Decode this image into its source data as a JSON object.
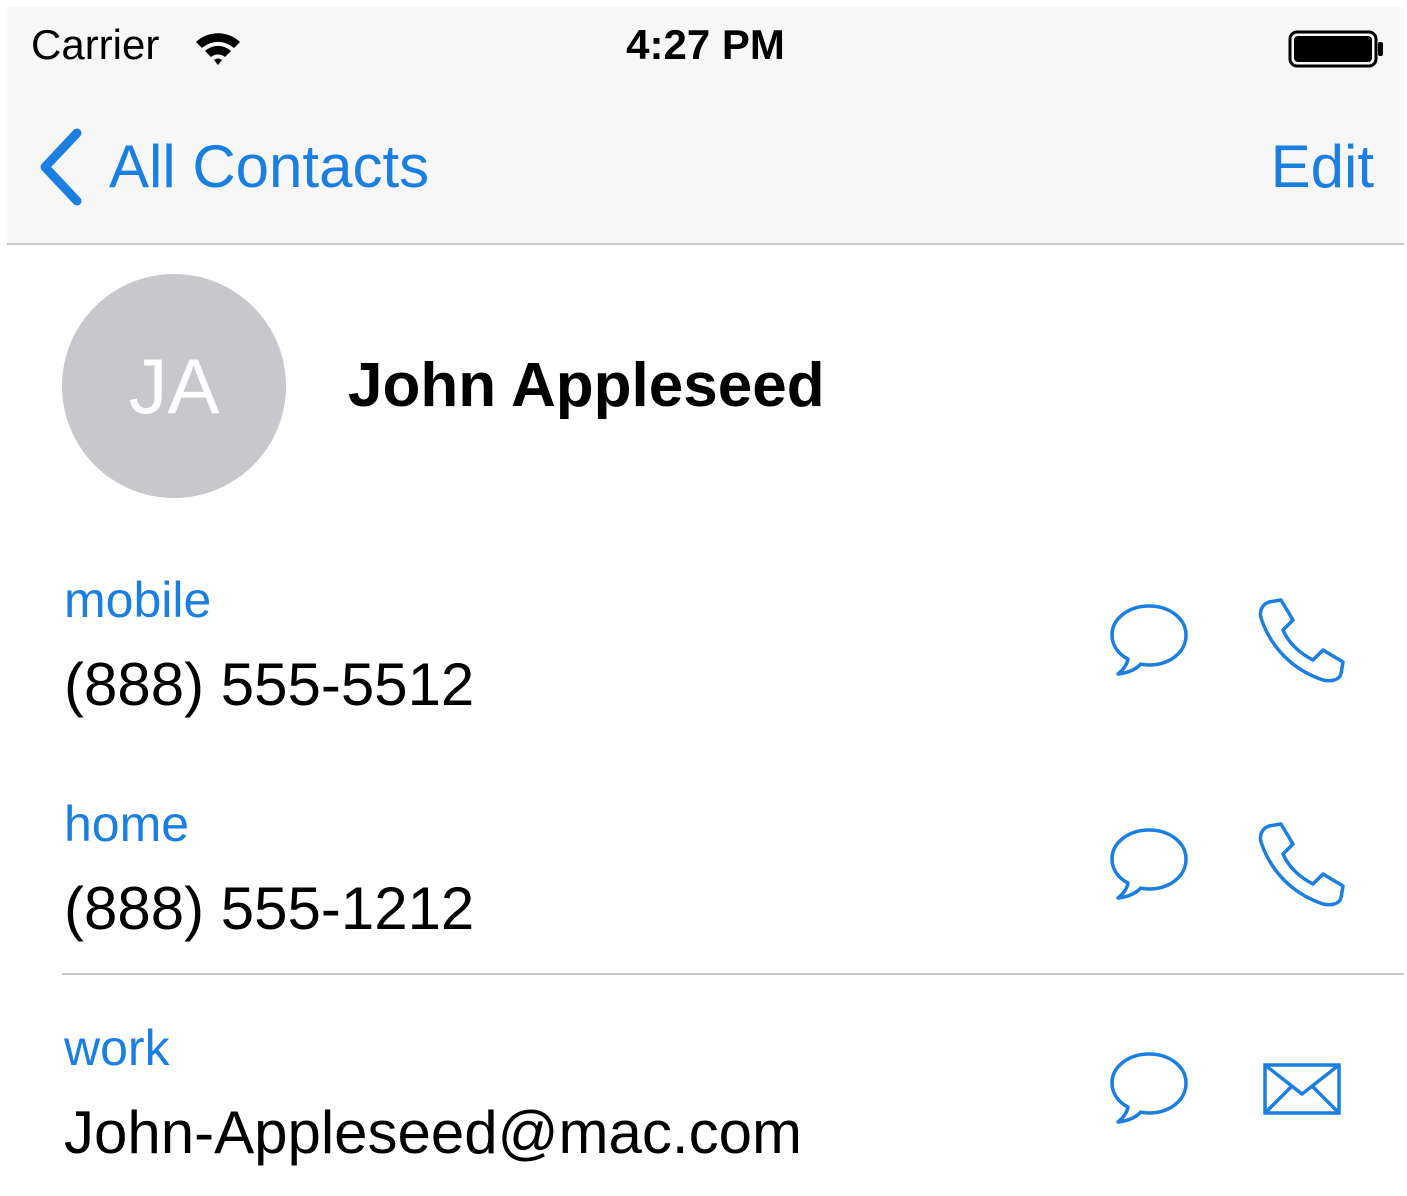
{
  "status_bar": {
    "carrier": "Carrier",
    "time": "4:27 PM"
  },
  "nav": {
    "back_label": "All Contacts",
    "edit_label": "Edit",
    "accent_color": "#1a7fe0"
  },
  "contact": {
    "initials": "JA",
    "name": "John Appleseed"
  },
  "fields": [
    {
      "label": "mobile",
      "value": "(888) 555-5512",
      "actions": [
        "message-icon",
        "phone-icon"
      ]
    },
    {
      "label": "home",
      "value": "(888) 555-1212",
      "actions": [
        "message-icon",
        "phone-icon"
      ]
    },
    {
      "label": "work",
      "value": "John-Appleseed@mac.com",
      "actions": [
        "message-icon",
        "mail-icon"
      ]
    }
  ]
}
